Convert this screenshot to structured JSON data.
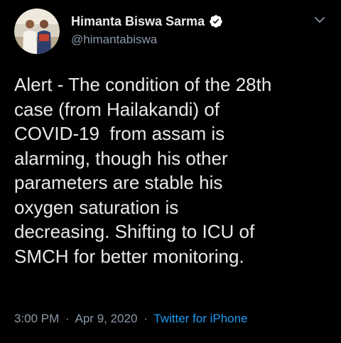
{
  "author": {
    "display_name": "Himanta Biswa Sarma",
    "handle": "@himantabiswa",
    "verified": true,
    "avatar_icon": "profile-photo"
  },
  "tweet": {
    "text": "Alert - The condition of the 28th\ncase (from Hailakandi) of\nCOVID-19  from assam is\nalarming, though his other\nparameters are stable his\noxygen saturation is\ndecreasing. Shifting to ICU of\nSMCH for better monitoring."
  },
  "meta": {
    "time": "3:00 PM",
    "date": "Apr 9, 2020",
    "separator": "·",
    "source": "Twitter for iPhone"
  },
  "menu": {
    "icon": "chevron-down-icon"
  },
  "colors": {
    "background": "#000000",
    "primary_text": "#e7e9ea",
    "secondary_text": "#8b98a5",
    "link": "#1d9bf0",
    "verified_badge": "#ffffff"
  }
}
